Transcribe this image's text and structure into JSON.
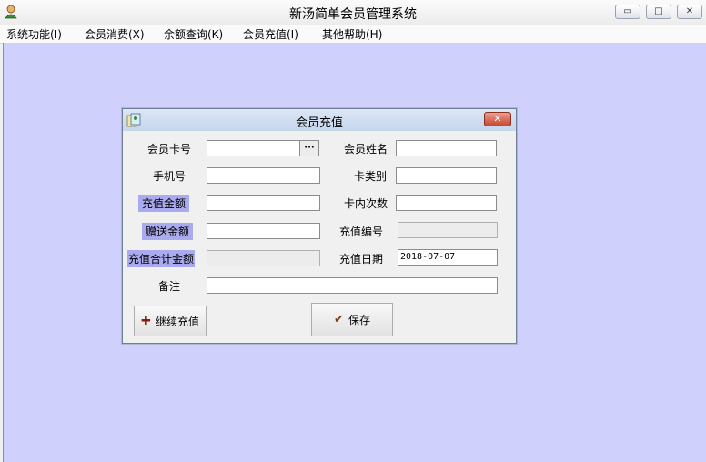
{
  "app": {
    "title": "新汤简单会员管理系统",
    "icon": "user-icon"
  },
  "window_controls": {
    "minimize": "▭",
    "maximize": "□",
    "close": "✕"
  },
  "menu": [
    {
      "label": "系统功能(I)"
    },
    {
      "label": "会员消费(X)"
    },
    {
      "label": "余额查询(K)"
    },
    {
      "label": "会员充值(I)"
    },
    {
      "label": "其他帮助(H)"
    }
  ],
  "dialog": {
    "title": "会员充值",
    "icon": "cards-icon",
    "close": "✕",
    "labels": {
      "card_no": "会员卡号",
      "member_name": "会员姓名",
      "phone": "手机号",
      "card_type": "卡类别",
      "recharge_amount": "充值金额",
      "times_in_card": "卡内次数",
      "gift_amount": "赠送金额",
      "recharge_no": "充值编号",
      "total_amount": "充值合计金额",
      "recharge_date": "充值日期",
      "remark": "备注"
    },
    "values": {
      "card_no": "",
      "member_name": "",
      "phone": "",
      "card_type": "",
      "recharge_amount": "",
      "times_in_card": "",
      "gift_amount": "",
      "recharge_no": "",
      "total_amount": "",
      "recharge_date": "2018-07-07",
      "remark": ""
    },
    "ellipsis": "···",
    "buttons": {
      "continue": {
        "label": "继续充值",
        "icon": "plus-icon",
        "glyph": "✚"
      },
      "save": {
        "label": "保存",
        "icon": "check-icon",
        "glyph": "✔"
      }
    },
    "colors": {
      "highlight_label_bg": "#aaaaee",
      "plus_icon": "#8b1a10",
      "check_icon": "#7a3b18"
    }
  },
  "colors": {
    "workspace_bg": "#d0d0fd"
  }
}
